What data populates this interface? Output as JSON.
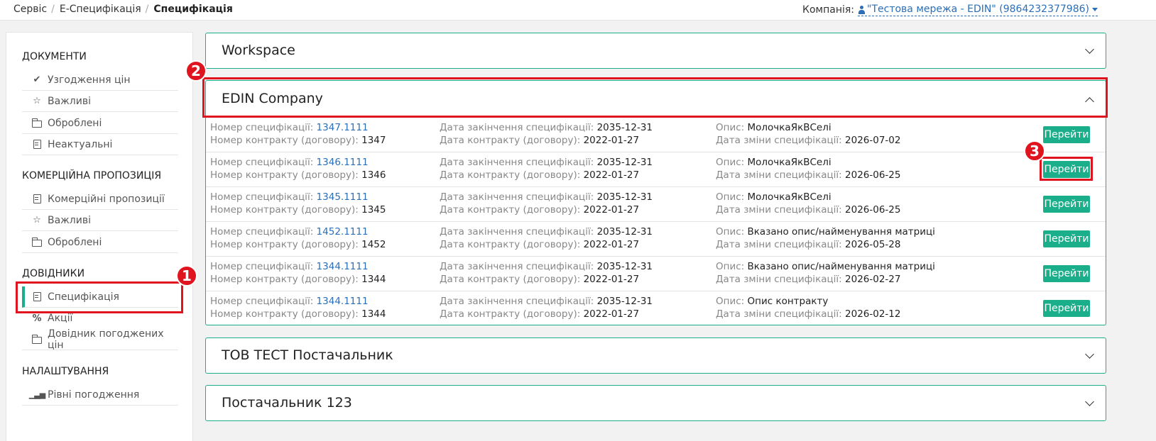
{
  "breadcrumb": [
    "Сервіс",
    "Е-Специфікація",
    "Специфікація"
  ],
  "company": {
    "label": "Компанія:",
    "name": "\"Тестова мережа - EDIN\" (9864232377986)"
  },
  "sidebar": {
    "sections": [
      {
        "title": "ДОКУМЕНТИ",
        "items": [
          {
            "label": "Узгодження цін",
            "icon": "check-icon"
          },
          {
            "label": "Важливі",
            "icon": "star-icon"
          },
          {
            "label": "Оброблені",
            "icon": "folder-icon"
          },
          {
            "label": "Неактуальні",
            "icon": "file-icon"
          }
        ]
      },
      {
        "title": "КОМЕРЦІЙНА ПРОПОЗИЦІЯ",
        "items": [
          {
            "label": "Комерційні пропозиції",
            "icon": "file-icon"
          },
          {
            "label": "Важливі",
            "icon": "star-icon"
          },
          {
            "label": "Оброблені",
            "icon": "folder-icon"
          }
        ]
      },
      {
        "title": "ДОВІДНИКИ",
        "items": [
          {
            "label": "Специфікація",
            "icon": "file-icon"
          },
          {
            "label": "Акції",
            "icon": "percent-icon"
          },
          {
            "label": "Довідник погоджених цін",
            "icon": "folder-open-icon"
          }
        ]
      },
      {
        "title": "НАЛАШТУВАННЯ",
        "items": [
          {
            "label": "Рівні погодження",
            "icon": "bar-chart-icon"
          }
        ]
      }
    ],
    "active_item": "Специфікація"
  },
  "panels": [
    {
      "title": "Workspace",
      "expanded": false
    },
    {
      "title": "EDIN Company",
      "expanded": true
    },
    {
      "title": "ТОВ ТЕСТ Постачальник",
      "expanded": false
    },
    {
      "title": "Постачальник 123",
      "expanded": false
    }
  ],
  "labels": {
    "spec_number": "Номер специфікації:",
    "contract_number": "Номер контракту (договору):",
    "end_date": "Дата закінчення специфікації:",
    "contract_date": "Дата контракту (договору):",
    "description": "Опис:",
    "change_date": "Дата зміни специфікації:",
    "go_button": "Перейти"
  },
  "rows": [
    {
      "spec": "1347.1111",
      "contract": "1347",
      "end": "2035-12-31",
      "cdate": "2022-01-27",
      "desc": "МолочкаЯкВСелі",
      "changed": "2026-07-02"
    },
    {
      "spec": "1346.1111",
      "contract": "1346",
      "end": "2035-12-31",
      "cdate": "2022-01-27",
      "desc": "МолочкаЯкВСелі",
      "changed": "2026-06-25"
    },
    {
      "spec": "1345.1111",
      "contract": "1345",
      "end": "2035-12-31",
      "cdate": "2022-01-27",
      "desc": "МолочкаЯкВСелі",
      "changed": "2026-06-25"
    },
    {
      "spec": "1452.1111",
      "contract": "1452",
      "end": "2035-12-31",
      "cdate": "2022-01-27",
      "desc": "Вказано опис/найменування матриці",
      "changed": "2026-05-28"
    },
    {
      "spec": "1344.1111",
      "contract": "1344",
      "end": "2035-12-31",
      "cdate": "2022-01-27",
      "desc": "Вказано опис/найменування матриці",
      "changed": "2026-02-27"
    },
    {
      "spec": "1344.1111",
      "contract": "1344",
      "end": "2035-12-31",
      "cdate": "2022-01-27",
      "desc": "Опис контракту",
      "changed": "2026-02-12"
    }
  ],
  "annotations": [
    "1",
    "2",
    "3"
  ],
  "colors": {
    "accent": "#1bae8a",
    "link": "#2a6fb8",
    "annotation": "#e0141e"
  }
}
